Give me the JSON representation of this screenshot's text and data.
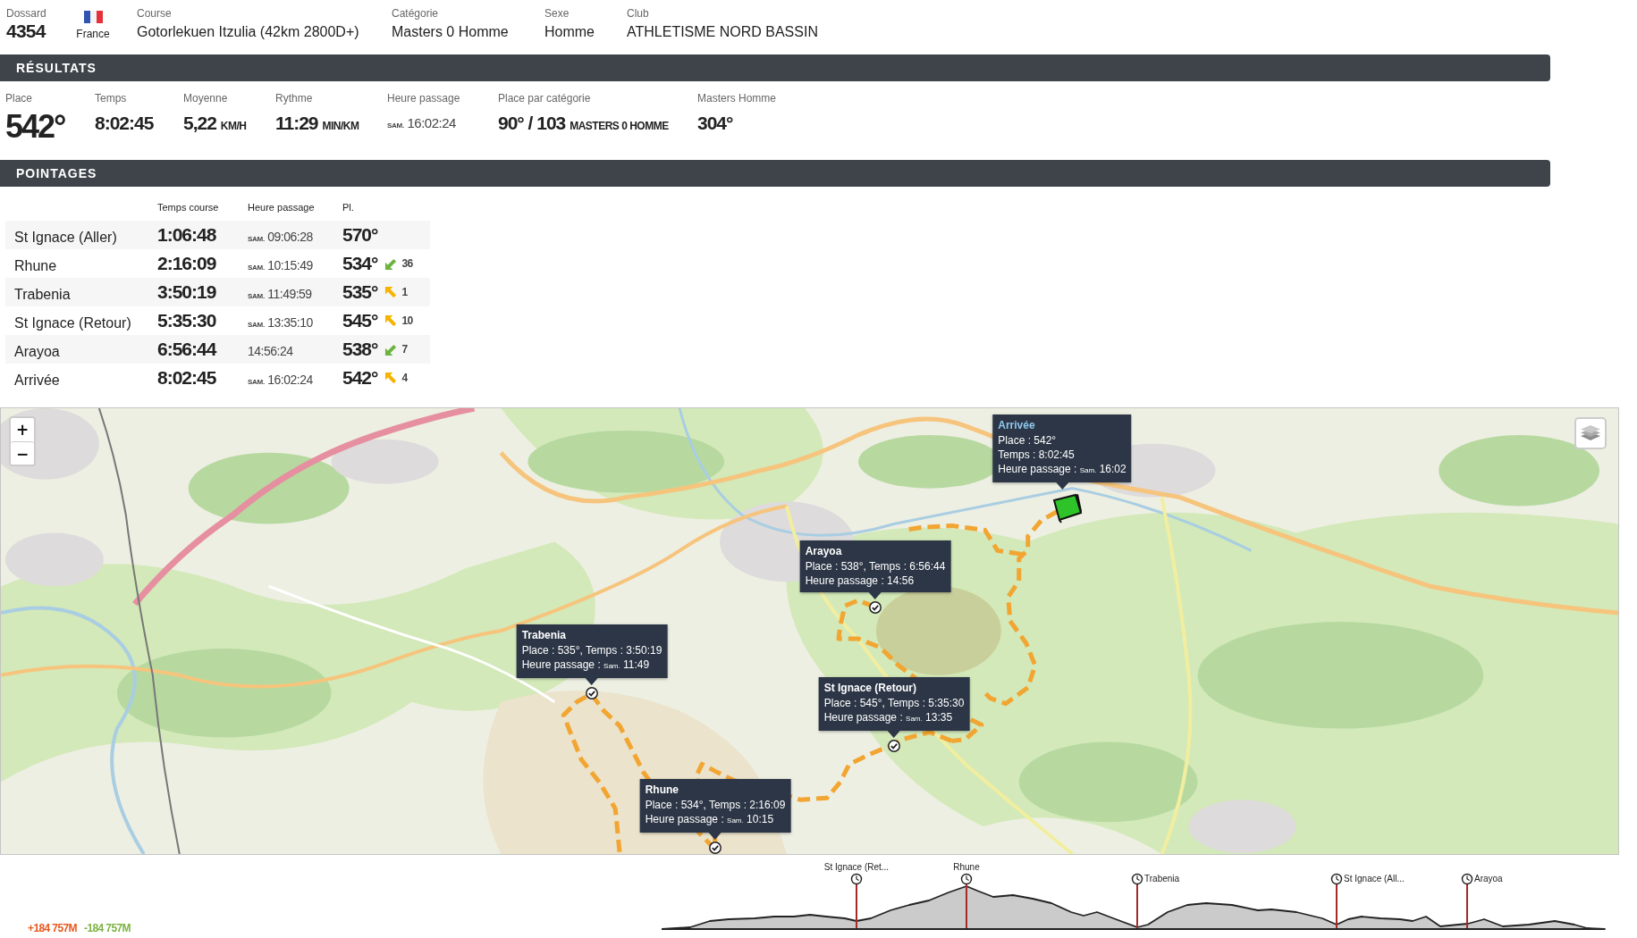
{
  "athlete": {
    "bib_label": "Dossard",
    "bib": "4354",
    "country": "France",
    "fields": [
      {
        "label": "Course",
        "value": "Gotorlekuen Itzulia (42km 2800D+)"
      },
      {
        "label": "Catégorie",
        "value": "Masters 0 Homme"
      },
      {
        "label": "Sexe",
        "value": "Homme"
      },
      {
        "label": "Club",
        "value": "ATHLETISME NORD BASSIN"
      }
    ]
  },
  "results": {
    "title": "RÉSULTATS",
    "items": [
      {
        "kind": "rank",
        "label": "Place",
        "value": "542°"
      },
      {
        "kind": "stat",
        "label": "Temps",
        "value": "8:02:45"
      },
      {
        "kind": "stat",
        "label": "Moyenne",
        "value": "5,22",
        "unit": "KM/H"
      },
      {
        "kind": "stat",
        "label": "Rythme",
        "value": "11:29",
        "unit": "MIN/KM"
      },
      {
        "kind": "clock",
        "label": "Heure passage",
        "day": "SAM.",
        "value": "16:02:24"
      },
      {
        "kind": "stat",
        "label": "Place par catégorie",
        "value": "90° / 103",
        "unit": "MASTERS 0 HOMME"
      },
      {
        "kind": "stat",
        "label": "Masters Homme",
        "value": "304°"
      }
    ]
  },
  "splits": {
    "title": "POINTAGES",
    "columns": [
      "Temps course",
      "Heure passage",
      "Pl."
    ],
    "rows": [
      {
        "name": "St Ignace (Aller)",
        "race_time": "1:06:48",
        "day": "SAM.",
        "clock": "09:06:28",
        "place": "570°"
      },
      {
        "name": "Rhune",
        "race_time": "2:16:09",
        "day": "SAM.",
        "clock": "10:15:49",
        "place": "534°",
        "gained": true,
        "change": "36"
      },
      {
        "name": "Trabenia",
        "race_time": "3:50:19",
        "day": "SAM.",
        "clock": "11:49:59",
        "place": "535°",
        "gained": false,
        "change": "1"
      },
      {
        "name": "St Ignace (Retour)",
        "race_time": "5:35:30",
        "day": "SAM.",
        "clock": "13:35:10",
        "place": "545°",
        "gained": false,
        "change": "10"
      },
      {
        "name": "Arayoa",
        "race_time": "6:56:44",
        "clock": "14:56:24",
        "place": "538°",
        "gained": true,
        "change": "7"
      },
      {
        "name": "Arrivée",
        "race_time": "8:02:45",
        "day": "SAM.",
        "clock": "16:02:24",
        "place": "542°",
        "gained": false,
        "change": "4"
      }
    ]
  },
  "map": {
    "zoom_in": "+",
    "zoom_out": "−",
    "popups": [
      {
        "kind": "finish",
        "title": "Arrivée",
        "lines": [
          "Place : 542°",
          "Temps : 8:02:45"
        ],
        "passage_label": "Heure passage :",
        "day": "Sam.",
        "time": "16:02"
      },
      {
        "kind": "checkpoint",
        "title": "Arayoa",
        "lines": [
          "Place : 538°, Temps : 6:56:44"
        ],
        "passage_label": "Heure passage :",
        "time": "14:56"
      },
      {
        "kind": "checkpoint",
        "title": "Trabenia",
        "lines": [
          "Place : 535°, Temps : 3:50:19"
        ],
        "passage_label": "Heure passage :",
        "day": "Sam.",
        "time": "11:49"
      },
      {
        "kind": "checkpoint",
        "title": "St Ignace (Retour)",
        "lines": [
          "Place : 545°, Temps : 5:35:30"
        ],
        "passage_label": "Heure passage :",
        "day": "Sam.",
        "time": "13:35"
      },
      {
        "kind": "checkpoint",
        "title": "Rhune",
        "lines": [
          "Place : 534°, Temps : 2:16:09"
        ],
        "passage_label": "Heure passage :",
        "day": "Sam.",
        "time": "10:15"
      }
    ]
  },
  "elevation": {
    "gain": "+184 757M",
    "loss": "-184 757M",
    "checkpoints": [
      "St Ignace (Ret...",
      "Rhune",
      "Trabenia",
      "St Ignace (All...",
      "Arayoa"
    ]
  }
}
